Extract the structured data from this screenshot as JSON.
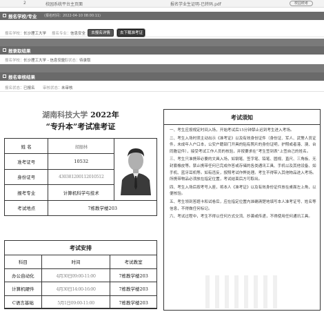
{
  "topbar": {
    "num": "2",
    "left_text": "校园系统平台主页面",
    "mid_text": "报名学业生证明-已转码.pdf",
    "logo": "校园统考"
  },
  "school_section": {
    "title": "报名学校/专业",
    "subtitle": "(报名时间：2022-04-10 08:00:11)",
    "row": {
      "school_label": "报名学校：",
      "school_value": "长沙理工大学",
      "major_label": "报名专业：",
      "major_value": "信息安全",
      "btn_view": "去报名详情",
      "btn_print": "去下载准考证"
    }
  },
  "score_section": {
    "title": "报录取结果",
    "row": {
      "school_label": "报名学校：",
      "school_value": "长沙理工大学 - 信息安全",
      "status_label": "录取状态：",
      "status_value": "待录取"
    }
  },
  "result_section": {
    "title": "报名审核结果",
    "row": {
      "label1": "报名状态：",
      "value1": "已报名",
      "label2": "审核状态：",
      "value2": "未审核"
    }
  },
  "ticket": {
    "title_blur": "湖南科技大学",
    "title_year": " 2022年",
    "subtitle": "“专升本”考试准考证",
    "rows": [
      {
        "label": "姓  名",
        "value": "胡振林"
      },
      {
        "label": "准考证号",
        "value": "10532"
      },
      {
        "label": "身份证号",
        "value": "430381200112010512"
      },
      {
        "label": "报考专业",
        "value": "计算机科学与技术"
      }
    ],
    "location_label": "考试地点",
    "location_value": "7栋教学楼203",
    "schedule_title": "考试安排",
    "schedule_headers": [
      "科目",
      "时间",
      "考试教室"
    ],
    "schedule": [
      {
        "subject": "办公自动化",
        "time": "4月30日09:00-11:00",
        "room": "7栋教学楼203"
      },
      {
        "subject": "计算机硬件",
        "time": "4月30日14:00-16:00",
        "room": "7栋教学楼203"
      },
      {
        "subject": "C语言基础",
        "time": "5月1日09:00-11:00",
        "room": "7栋教学楼203"
      }
    ]
  },
  "notice": {
    "title": "考试须知",
    "paragraphs": [
      "一、考生应按规定时间入场，开始考试后15分钟禁止迟到考生进入考场。",
      "二、考生入场时须主动出示《准考证》以及有效身份证件（身份证、军人、武警人员证件，未成年人户口本，公安户籍部门开具的贴有照片的身份证明，护照或者港、澳、台同胞证件），接受考试工作人员的核验，并按要求在“考生签到表”上签自己的姓名。",
      "三、考生只准携带必要的文具入场，如钢笔、签字笔、铅笔、圆规、直尺、三角板、无封套橡皮等。禁止携带任何已完成作答或存储的各类通讯工具、手机以及其他设备、如手机、蓝牙耳机等。如有违反，按照考试作弊处理。考生不得带入其他物品进入考场。所携带物品必须放在指定位置，考试结束后方可取出。",
      "四、考生入场后按考号入座，将本人《准考证》以及有效身份证件放在桌面左上角，以便核验。",
      "五、考生领到答题卡和试卷后，应在指定位置内准确清楚地填写本人准考证号、姓名等信息，不得做任何标记。",
      "六、考试过程中，考生不得以任何方式交流、抄袭或传递，不得使用任何通讯工具。"
    ]
  },
  "colors": {
    "header_bg": "#6a6a6a",
    "band": "#7a7a7a",
    "print_btn": "#3d3d3d"
  }
}
